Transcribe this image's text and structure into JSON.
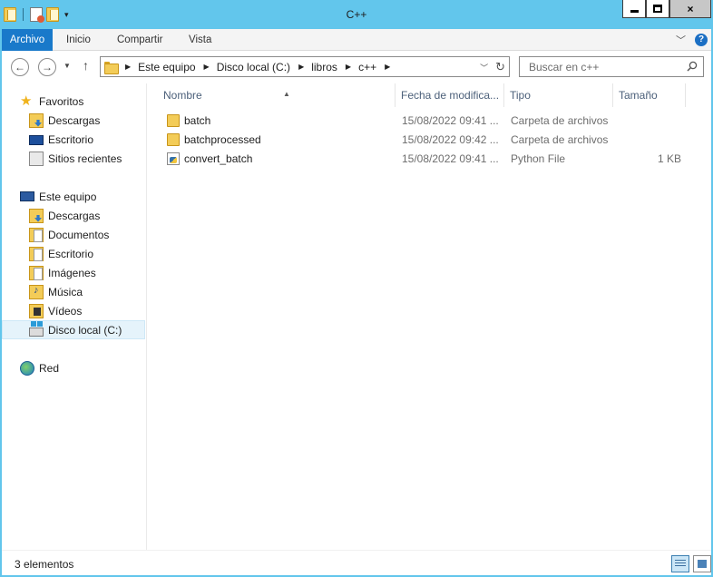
{
  "window": {
    "title": "C++",
    "caption": {
      "minimize": "minimize",
      "maximize": "maximize",
      "close": "×"
    }
  },
  "ribbon": {
    "tabs": [
      "Archivo",
      "Inicio",
      "Compartir",
      "Vista"
    ],
    "help": "?"
  },
  "address": {
    "crumbs": [
      "Este equipo",
      "Disco local (C:)",
      "libros",
      "c++"
    ],
    "search_placeholder": "Buscar en c++"
  },
  "sidebar": {
    "favorites": {
      "label": "Favoritos",
      "items": [
        "Descargas",
        "Escritorio",
        "Sitios recientes"
      ]
    },
    "this_pc": {
      "label": "Este equipo",
      "items": [
        "Descargas",
        "Documentos",
        "Escritorio",
        "Imágenes",
        "Música",
        "Vídeos",
        "Disco local (C:)"
      ],
      "selected": "Disco local (C:)"
    },
    "network": {
      "label": "Red"
    }
  },
  "columns": [
    "Nombre",
    "Fecha de modifica...",
    "Tipo",
    "Tamaño"
  ],
  "files": [
    {
      "name": "batch",
      "date": "15/08/2022 09:41 ...",
      "type": "Carpeta de archivos",
      "size": "",
      "icon": "folder-icon"
    },
    {
      "name": "batchprocessed",
      "date": "15/08/2022 09:42 ...",
      "type": "Carpeta de archivos",
      "size": "",
      "icon": "folder-icon"
    },
    {
      "name": "convert_batch",
      "date": "15/08/2022 09:41 ...",
      "type": "Python File",
      "size": "1 KB",
      "icon": "python-file-icon"
    }
  ],
  "status": {
    "count": "3 elementos"
  }
}
